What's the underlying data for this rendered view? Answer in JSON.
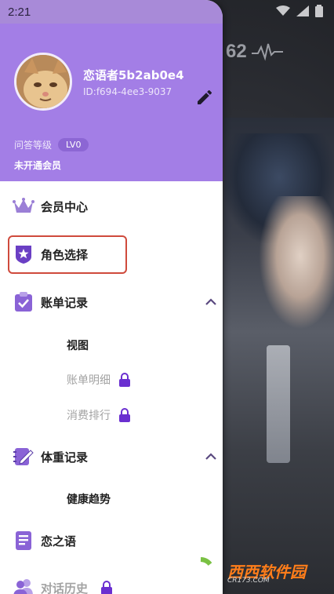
{
  "status_bar": {
    "time": "2:21"
  },
  "background_app": {
    "heart_rate": "62"
  },
  "profile": {
    "username": "恋语者5b2ab0e4",
    "user_id": "ID:f694-4ee3-9037",
    "level_label": "问答等级",
    "level_badge": "LV0",
    "vip_status": "未开通会员"
  },
  "menu": {
    "vip_center": "会员中心",
    "role_select": "角色选择",
    "bill_records": {
      "label": "账单记录",
      "children": [
        "视图",
        "账单明细",
        "消费排行"
      ]
    },
    "weight_records": {
      "label": "体重记录",
      "children": [
        "健康趋势"
      ]
    },
    "love_words": "恋之语",
    "chat_history": "对话历史"
  },
  "watermark": {
    "brand": "西西软件园",
    "domain": "CR173.COM"
  },
  "colors": {
    "header": "#a37ee6",
    "accent": "#6a3fc4",
    "highlight_border": "#cf4a3c",
    "badge": "#8c66d4"
  }
}
